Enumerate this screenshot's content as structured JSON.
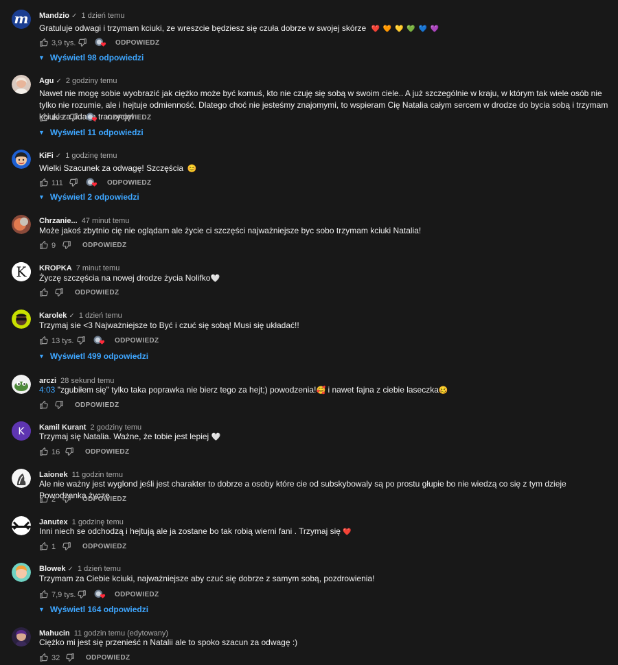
{
  "comments": [
    {
      "author": "Mandzio",
      "verified": true,
      "time": "1 dzień temu",
      "text": "Gratuluje odwagi i trzymam kciuki, ze wreszcie będziesz się czuła dobrze w swojej skórze",
      "emoji": "❤️ 🧡 💛 💚 💙 💜",
      "likes": "3,9 tys.",
      "creator_heart": true,
      "reply_label": "ODPOWIEDZ",
      "replies": "Wyświetl 98 odpowiedzi",
      "avatar_letter": "m"
    },
    {
      "author": "Agu",
      "verified": true,
      "time": "2 godziny temu",
      "text": "Nawet nie mogę sobie wyobrazić jak ciężko może być komuś, kto nie czuję się sobą w swoim ciele.. A już szczególnie w kraju, w którym tak wiele osób nie tylko nie rozumie, ale i hejtuje odmienność. Dlatego choć nie jesteśmy znajomymi, to wspieram Cię Natalia całym sercem w drodze do bycia sobą i trzymam kciuki za udaną tranzycję!",
      "likes": "199",
      "creator_heart": true,
      "reply_label": "ODPOWIEDZ",
      "replies": "Wyświetl 11 odpowiedzi"
    },
    {
      "author": "KiFi",
      "verified": true,
      "time": "1 godzinę temu",
      "text": "Wielki Szacunek za odwagę! Szczęścia",
      "emoji": "😊",
      "likes": "111",
      "creator_heart": true,
      "reply_label": "ODPOWIEDZ",
      "replies": "Wyświetl 2 odpowiedzi"
    },
    {
      "author": "Chrzanie...",
      "verified": false,
      "time": "47 minut temu",
      "text": "Może jakoś zbytnio cię nie oglądam ale życie ci szczęści najważniejsze byc sobo trzymam kciuki Natalia!",
      "likes": "9",
      "reply_label": "ODPOWIEDZ"
    },
    {
      "author": "KROPKA",
      "verified": false,
      "time": "7 minut temu",
      "text": "Życzę szczęścia na nowej drodze życia Nolifko",
      "emoji": "🤍",
      "likes": "",
      "reply_label": "ODPOWIEDZ",
      "avatar_letter": "K"
    },
    {
      "author": "Karolek",
      "verified": true,
      "time": "1 dzień temu",
      "text": "Trzymaj sie <3 Najważniejsze to Być i czuć się sobą! Musi się układać!!",
      "likes": "13 tys.",
      "creator_heart": true,
      "reply_label": "ODPOWIEDZ",
      "replies": "Wyświetl 499 odpowiedzi"
    },
    {
      "author": "arczi",
      "verified": false,
      "time": "28 sekund temu",
      "timestamp": "4:03",
      "text": "\"zgubiłem się\" tylko taka poprawka nie bierz tego za hejt;) powodzenia!",
      "emoji": "🥰",
      "text2": " i nawet fajna z ciebie laseczka",
      "emoji2": "🥴",
      "likes": "",
      "reply_label": "ODPOWIEDZ"
    },
    {
      "author": "Kamil Kurant",
      "verified": false,
      "time": "2 godziny temu",
      "text": "Trzymaj się Natalia. Ważne, że tobie jest lepiej",
      "emoji": "🤍",
      "likes": "16",
      "reply_label": "ODPOWIEDZ",
      "avatar_letter": "K"
    },
    {
      "author": "Laionek",
      "verified": false,
      "time": "11 godzin temu",
      "text": "Ale nie ważny jest wyglond jeśli jest charakter to dobrze a osoby które cie od subskybowaly są po prostu głupie bo nie wiedzą co się z tym dzieje Powodzanka życze",
      "likes": "2",
      "reply_label": "ODPOWIEDZ"
    },
    {
      "author": "Janutex",
      "verified": false,
      "time": "1 godzinę temu",
      "text": "Inni niech se odchodzą i hejtują ale ja zostane bo tak robią wierni fani . Trzymaj się",
      "emoji": "❤️",
      "likes": "1",
      "reply_label": "ODPOWIEDZ"
    },
    {
      "author": "Blowek",
      "verified": true,
      "time": "1 dzień temu",
      "text": "Trzymam za Ciebie kciuki, najważniejsze aby czuć się dobrze z samym sobą, pozdrowienia!",
      "likes": "7,9 tys.",
      "creator_heart": true,
      "reply_label": "ODPOWIEDZ",
      "replies": "Wyświetl 164 odpowiedzi"
    },
    {
      "author": "Mahucin",
      "verified": false,
      "time": "11 godzin temu (edytowany)",
      "text": "Ciężko mi jest się przenieść n Natalii ale to spoko szacun za odwagę :)",
      "likes": "32",
      "reply_label": "ODPOWIEDZ"
    }
  ],
  "colors": {
    "background": "#181818",
    "link": "#3ea6ff",
    "muted": "#aaaaaa"
  }
}
